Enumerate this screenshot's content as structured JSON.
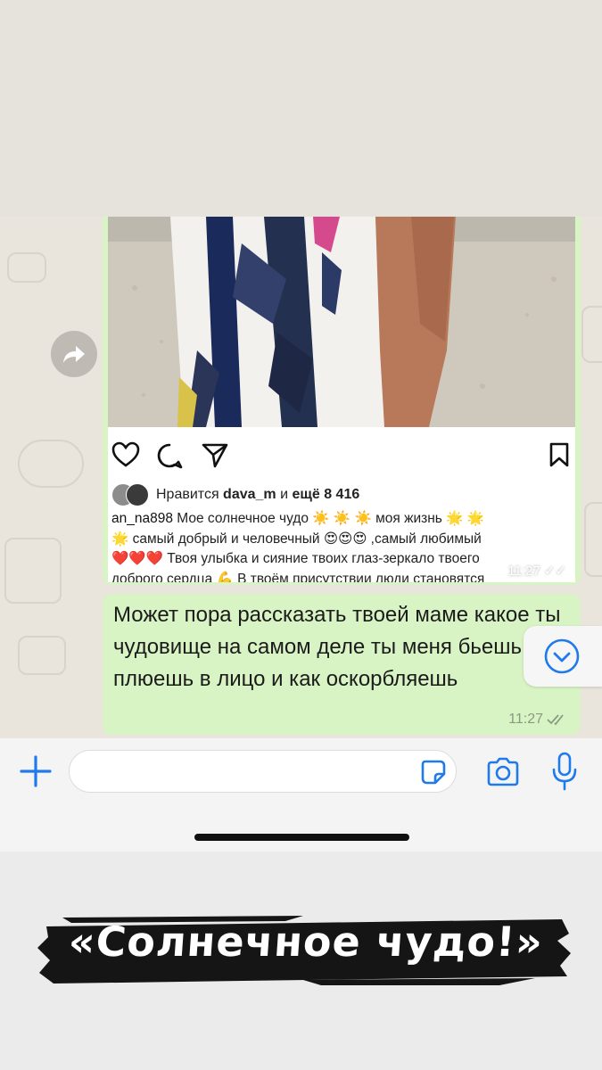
{
  "instagram_post": {
    "likes_prefix": "Нравится ",
    "likes_user": "dava_m",
    "likes_middle": " и ",
    "likes_count": "ещё 8 416",
    "caption_user": "an_na898",
    "caption_line1": " Мое солнечное чудо ☀️ ☀️ ☀️ моя жизнь 🌟 🌟",
    "caption_line2": "🌟 самый добрый и человечный 😍😍😍 ,самый любимый",
    "caption_line3": "❤️❤️❤️ Твоя улыбка и сияние твоих глаз-зеркало твоего",
    "caption_line4": "доброго сердца 💪 В твоём присутствии люди становятся",
    "time": "11:27"
  },
  "message": {
    "text": "Может пора рассказать твоей маме какое ты чудовище на самом деле ты меня бьешь плюешь в лицо и как оскорбляешь",
    "time": "11:27"
  },
  "headline": "«Солнечное чудо!»",
  "colors": {
    "bubble": "#d9f4c4",
    "accent_blue": "#1f7aeb",
    "chat_bg": "#e9e4dc"
  },
  "icons": [
    "forward-icon",
    "heart-icon",
    "comment-icon",
    "share-icon",
    "bookmark-icon",
    "chevron-down-icon",
    "plus-icon",
    "sticker-icon",
    "camera-icon",
    "microphone-icon"
  ]
}
